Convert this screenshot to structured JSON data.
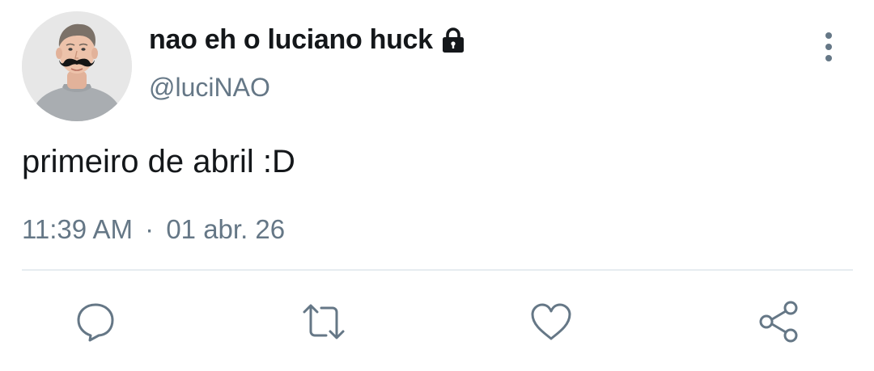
{
  "user": {
    "display_name": "nao eh o luciano huck",
    "handle": "@luciNAO",
    "protected_icon": "lock-icon",
    "avatar": "profile-photo-with-mustache"
  },
  "tweet": {
    "text": "primeiro de abril :D",
    "time": "11:39 AM",
    "separator": "·",
    "date": "01 abr. 26"
  },
  "menu": {
    "icon": "more-vertical-icon"
  },
  "actions": [
    {
      "name": "reply",
      "icon": "speech-bubble-icon"
    },
    {
      "name": "retweet",
      "icon": "retweet-arrows-icon"
    },
    {
      "name": "like",
      "icon": "heart-icon"
    },
    {
      "name": "share",
      "icon": "share-nodes-icon"
    }
  ],
  "colors": {
    "text_primary": "#14171a",
    "text_secondary": "#657786",
    "icon": "#657786",
    "divider": "#e6ecf0"
  }
}
